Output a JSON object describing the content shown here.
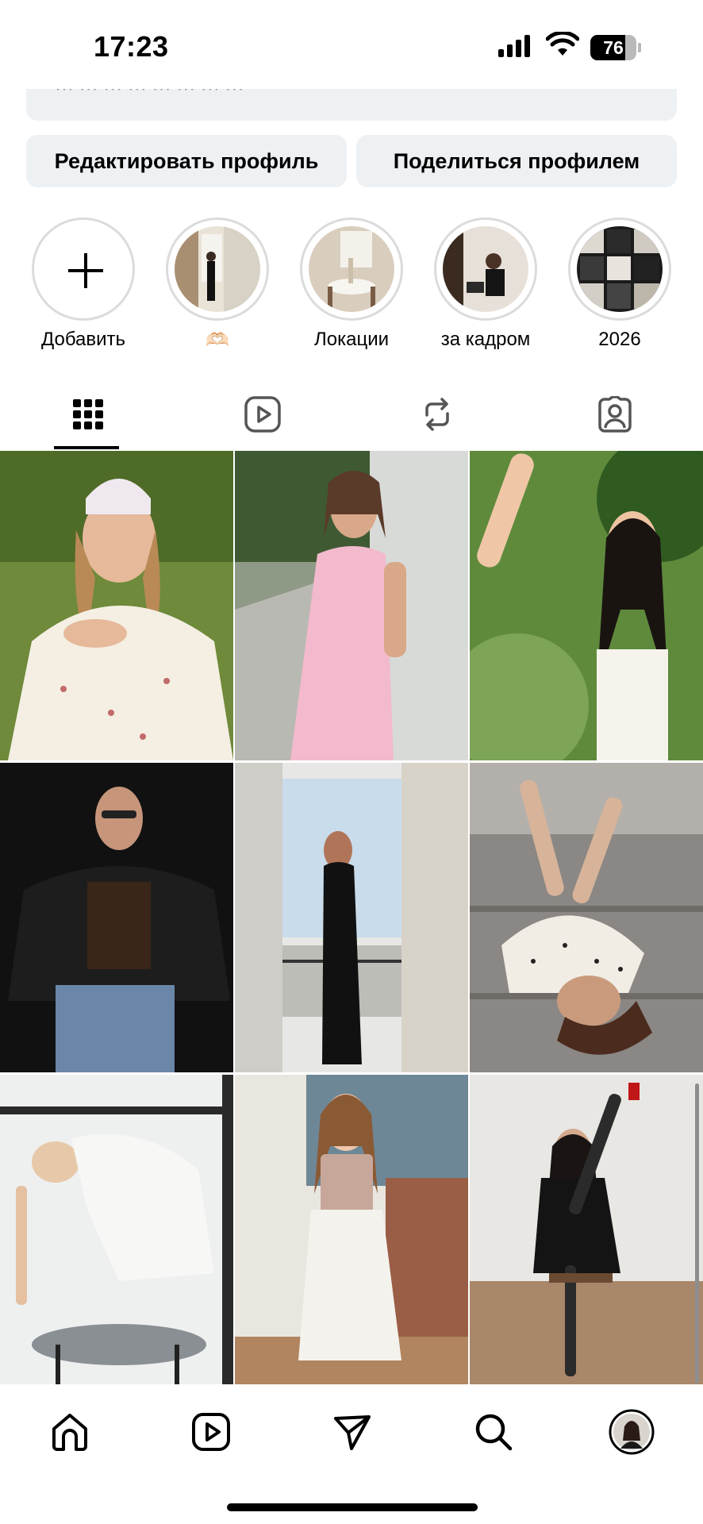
{
  "status_bar": {
    "time": "17:23",
    "battery_level": "76",
    "battery_fraction": 0.76
  },
  "bio": {
    "partial_text": "··· ··· ··· ··· ··· ··· ··· ···"
  },
  "profile_actions": {
    "edit_label": "Редактировать профиль",
    "share_label": "Поделиться профилем"
  },
  "highlights": [
    {
      "label": "Добавить",
      "kind": "add"
    },
    {
      "label": "🫶🏻",
      "kind": "photo"
    },
    {
      "label": "Локации",
      "kind": "photo"
    },
    {
      "label": "за кадром",
      "kind": "photo"
    },
    {
      "label": "2026",
      "kind": "photo"
    }
  ],
  "tabs": [
    {
      "icon": "grid-icon",
      "active": true
    },
    {
      "icon": "reels-icon",
      "active": false
    },
    {
      "icon": "reposts-icon",
      "active": false
    },
    {
      "icon": "tagged-icon",
      "active": false
    }
  ],
  "posts": [
    {
      "icon": "photo-woman-headscarf-floral-dress"
    },
    {
      "icon": "photo-woman-pink-dress-wall"
    },
    {
      "icon": "photo-woman-foliage-sunlight"
    },
    {
      "icon": "photo-woman-leather-jacket-sunglasses"
    },
    {
      "icon": "photo-woman-black-dress-balcony"
    },
    {
      "icon": "photo-woman-lying-stairs-polka-dot"
    },
    {
      "icon": "photo-woman-white-outfit-stool"
    },
    {
      "icon": "photo-woman-corset-white-pants"
    },
    {
      "icon": "photo-woman-black-suit-chair"
    }
  ],
  "bottom_nav": [
    {
      "icon": "home-icon"
    },
    {
      "icon": "reels-icon"
    },
    {
      "icon": "direct-message-icon"
    },
    {
      "icon": "search-icon"
    },
    {
      "icon": "profile-avatar"
    }
  ],
  "colors": {
    "button_bg": "#eef1f4",
    "ring": "#dbdbdb",
    "text": "#000000"
  }
}
